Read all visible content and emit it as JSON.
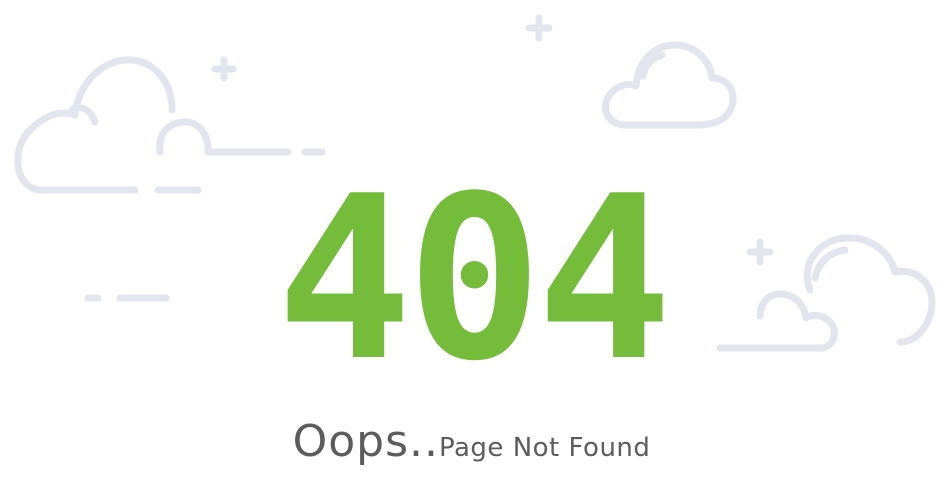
{
  "error_page": {
    "code": "404",
    "message_primary": "Oops..",
    "message_secondary": "Page Not Found"
  },
  "colors": {
    "accent": "#76bc3b",
    "text": "#5c5c5c",
    "cloud_stroke": "#e2e5ee",
    "background": "#ffffff"
  },
  "icons": [
    "cloud-icon",
    "plus-icon"
  ]
}
